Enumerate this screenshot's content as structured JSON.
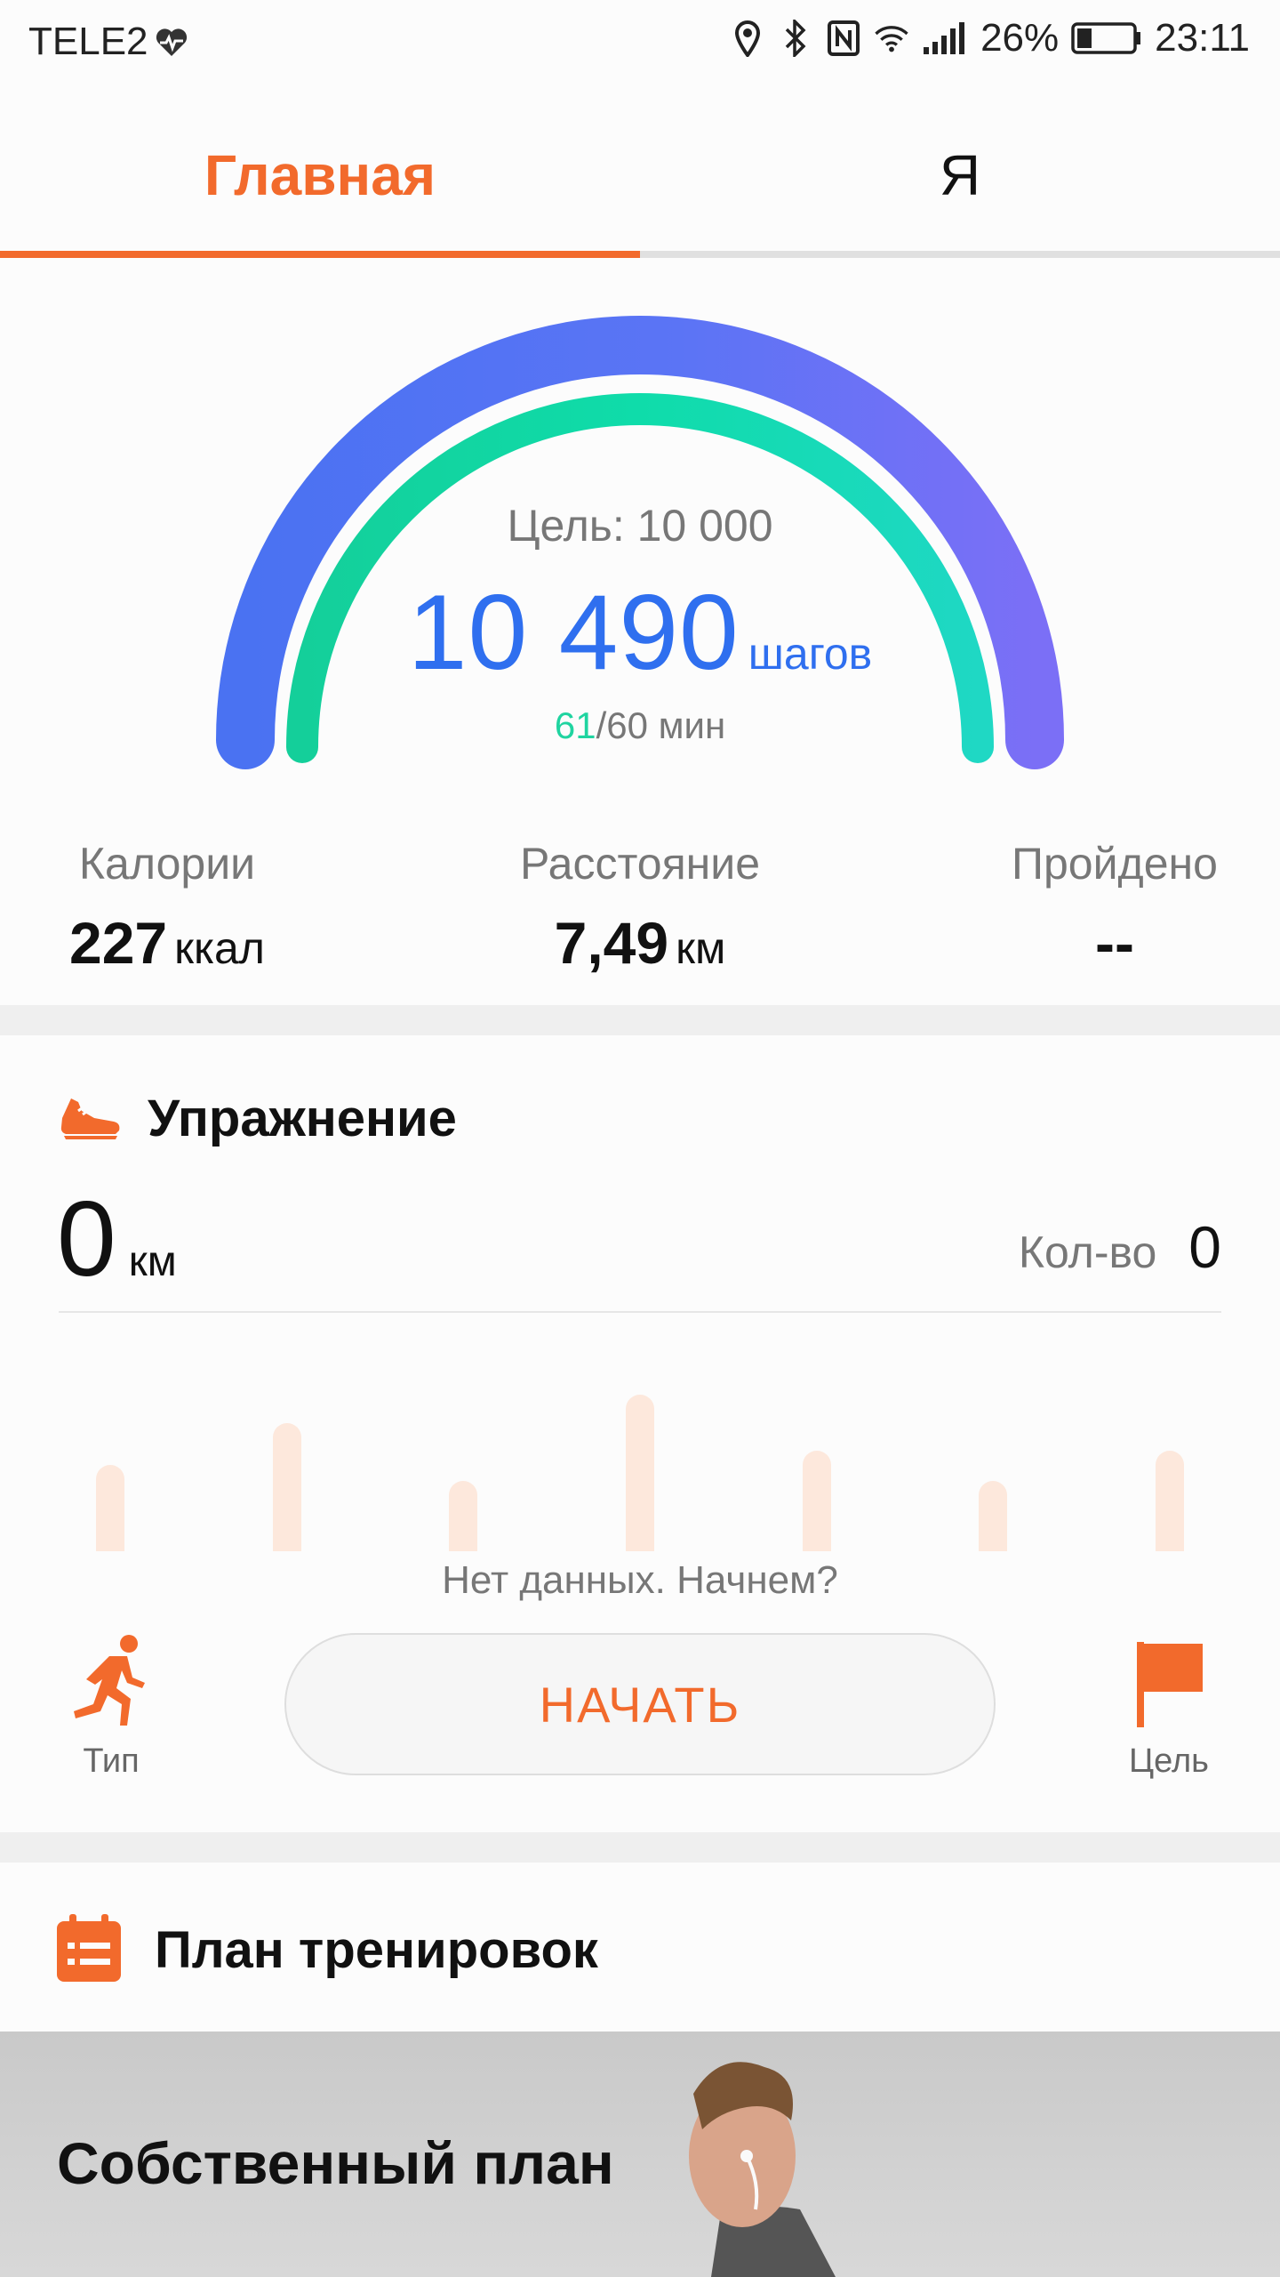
{
  "status_bar": {
    "carrier": "TELE2",
    "battery_percent": "26%",
    "time": "23:11",
    "icons": [
      "heart-pulse-icon",
      "location-icon",
      "bluetooth-icon",
      "nfc-icon",
      "wifi-icon",
      "signal-icon",
      "battery-icon"
    ]
  },
  "tabs": [
    {
      "label": "Главная",
      "active": true
    },
    {
      "label": "Я",
      "active": false
    }
  ],
  "steps": {
    "goal_label": "Цель: 10 000",
    "value": "10 490",
    "unit": "шагов",
    "minutes_current": "61",
    "minutes_goal": "/60 мин",
    "progress_fraction": 1.0
  },
  "stats": [
    {
      "label": "Калории",
      "value": "227",
      "unit": "ккал"
    },
    {
      "label": "Расстояние",
      "value": "7,49",
      "unit": "км"
    },
    {
      "label": "Пройдено",
      "value": "--",
      "unit": ""
    }
  ],
  "exercise": {
    "title": "Упражнение",
    "distance_value": "0",
    "distance_unit": "км",
    "count_label": "Кол-во",
    "count_value": "0",
    "no_data_text": "Нет данных. Начнем?",
    "type_label": "Тип",
    "start_label": "НАЧАТЬ",
    "goal_label": "Цель",
    "placeholder_bars": [
      0.55,
      0.82,
      0.45,
      1.0,
      0.64,
      0.45,
      0.64
    ]
  },
  "plan": {
    "title": "План тренировок",
    "banner_title": "Собственный план"
  },
  "colors": {
    "accent": "#f26a2c",
    "steps_blue": "#2f6fef",
    "green": "#1fd4a0",
    "bar_placeholder": "#fde8dc"
  }
}
